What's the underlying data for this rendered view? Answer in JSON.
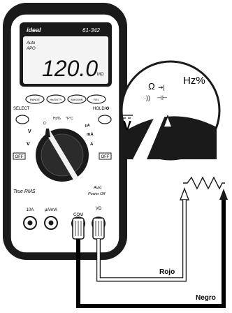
{
  "meter": {
    "brand": "ideal",
    "model": "61-342",
    "display": {
      "mode_top": "Auto",
      "mode_bottom": "APO",
      "reading": "120.0",
      "unit": "MΩ"
    },
    "buttons": [
      "RANGE",
      "Hz/DUTY",
      "MAX/MIN",
      "REL"
    ],
    "side_buttons": {
      "select": "SELECT",
      "hold": "HOLD/✪"
    },
    "dial_labels": {
      "hz": "Hz%",
      "temp": "°F°C",
      "ua": "µA",
      "ma": "mA",
      "a": "A",
      "off_left": "OFF",
      "off_right": "OFF",
      "v_dc": "V",
      "v_ac": "V"
    },
    "true_rms": "True RMS",
    "auto_power_off": [
      "Auto",
      "Power Off"
    ],
    "jacks": {
      "a10": "10A",
      "ua_ma": "µA/mA",
      "com": "COM",
      "v_ohm": "VΩ"
    }
  },
  "zoom": {
    "ohm_symbol": "Ω",
    "diode_symbol": "➞|",
    "cap_symbol": "⊣⊢",
    "sound_symbol": "·))",
    "hz_label": "Hz%",
    "vdc_label": "V"
  },
  "leads": {
    "red": "Rojo",
    "black": "Negro"
  },
  "colors": {
    "meter_body": "#1a1a1a",
    "lcd": "#f4f4f4",
    "lead": "#000000"
  }
}
